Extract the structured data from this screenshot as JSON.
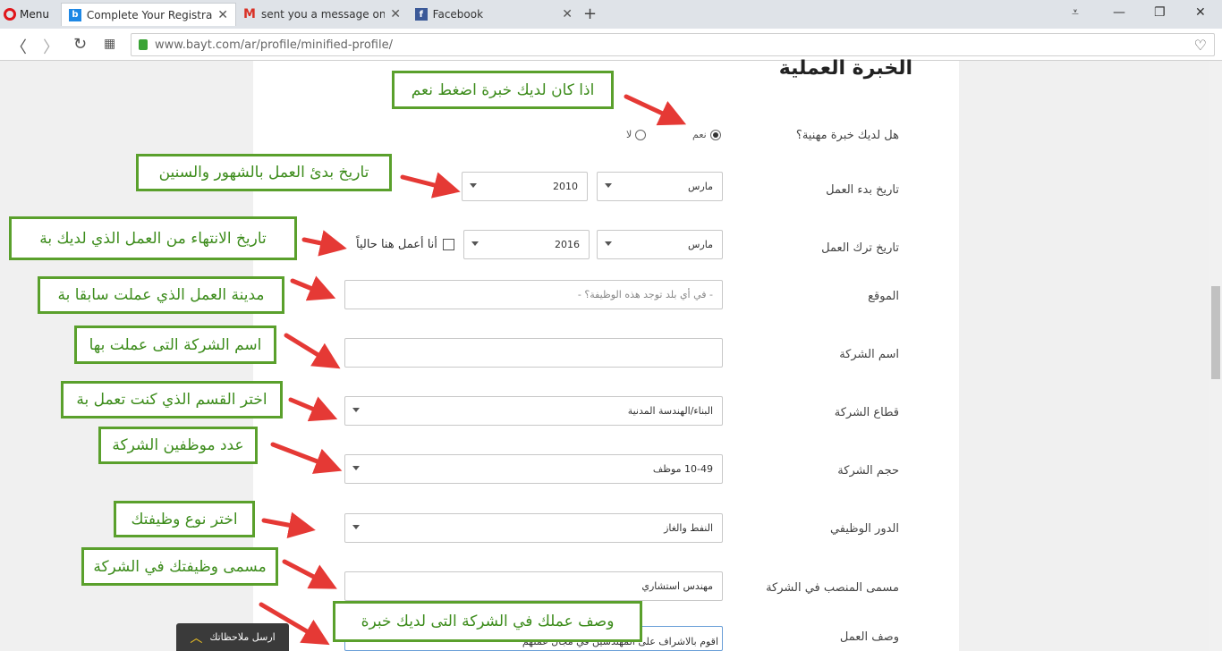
{
  "browser": {
    "menu_label": "Menu",
    "tabs": [
      {
        "title": "Complete Your Registration",
        "icon": "bayt-favicon"
      },
      {
        "title": "sent you a message on EN",
        "icon": "gmail-favicon"
      },
      {
        "title": "Facebook",
        "icon": "facebook-favicon"
      }
    ],
    "url": "www.bayt.com/ar/profile/minified-profile/",
    "accent": "#e0161b"
  },
  "form": {
    "section_title": "الخبرة العملية",
    "experience_question": "هل لديك خبرة مهنية؟",
    "yes_label": "نعم",
    "no_label": "لا",
    "start_date_label": "تاريخ بدء العمل",
    "start_month": "مارس",
    "start_year": "2010",
    "end_date_label": "تاريخ ترك العمل",
    "end_month": "مارس",
    "end_year": "2016",
    "currently_working_label": "أنا أعمل هنا حالياً",
    "location_label": "الموقع",
    "location_placeholder": "- في أي بلد توجد هذه الوظيفة؟ -",
    "company_name_label": "اسم الشركة",
    "company_name_value": "",
    "company_sector_label": "قطاع الشركة",
    "company_sector_value": "البناء/الهندسة المدنية",
    "company_size_label": "حجم الشركة",
    "company_size_value": "10-49 موظف",
    "job_role_label": "الدور الوظيفي",
    "job_role_value": "النفط والغاز",
    "job_title_label": "مسمى المنصب في الشركة",
    "job_title_value": "مهندس استشاري",
    "job_description_label": "وصف العمل",
    "job_description_value": "اقوم بالاشراف على المهندسين في مجال عملهم"
  },
  "annotations": {
    "yes_hint": "اذا كان لديك خبرة اضغط نعم",
    "start_hint": "تاريخ بدئ العمل بالشهور والسنين",
    "end_hint": "تاريخ الانتهاء من العمل الذي لديك بة",
    "location_hint": "مدينة العمل الذي  عملت سابقا بة",
    "company_hint": "اسم الشركة التى عملت بها",
    "sector_hint": "اختر القسم الذي كنت تعمل بة",
    "size_hint": "عدد موظفين الشركة",
    "role_hint": "اختر نوع وظيفتك",
    "title_hint": "مسمى وظيفتك في الشركة",
    "desc_hint": "وصف عملك في الشركة التى لديك خبرة"
  },
  "feedback_button": "ارسل ملاحظاتك",
  "annotation_color": "#5aa02c",
  "arrow_color": "#e53935"
}
